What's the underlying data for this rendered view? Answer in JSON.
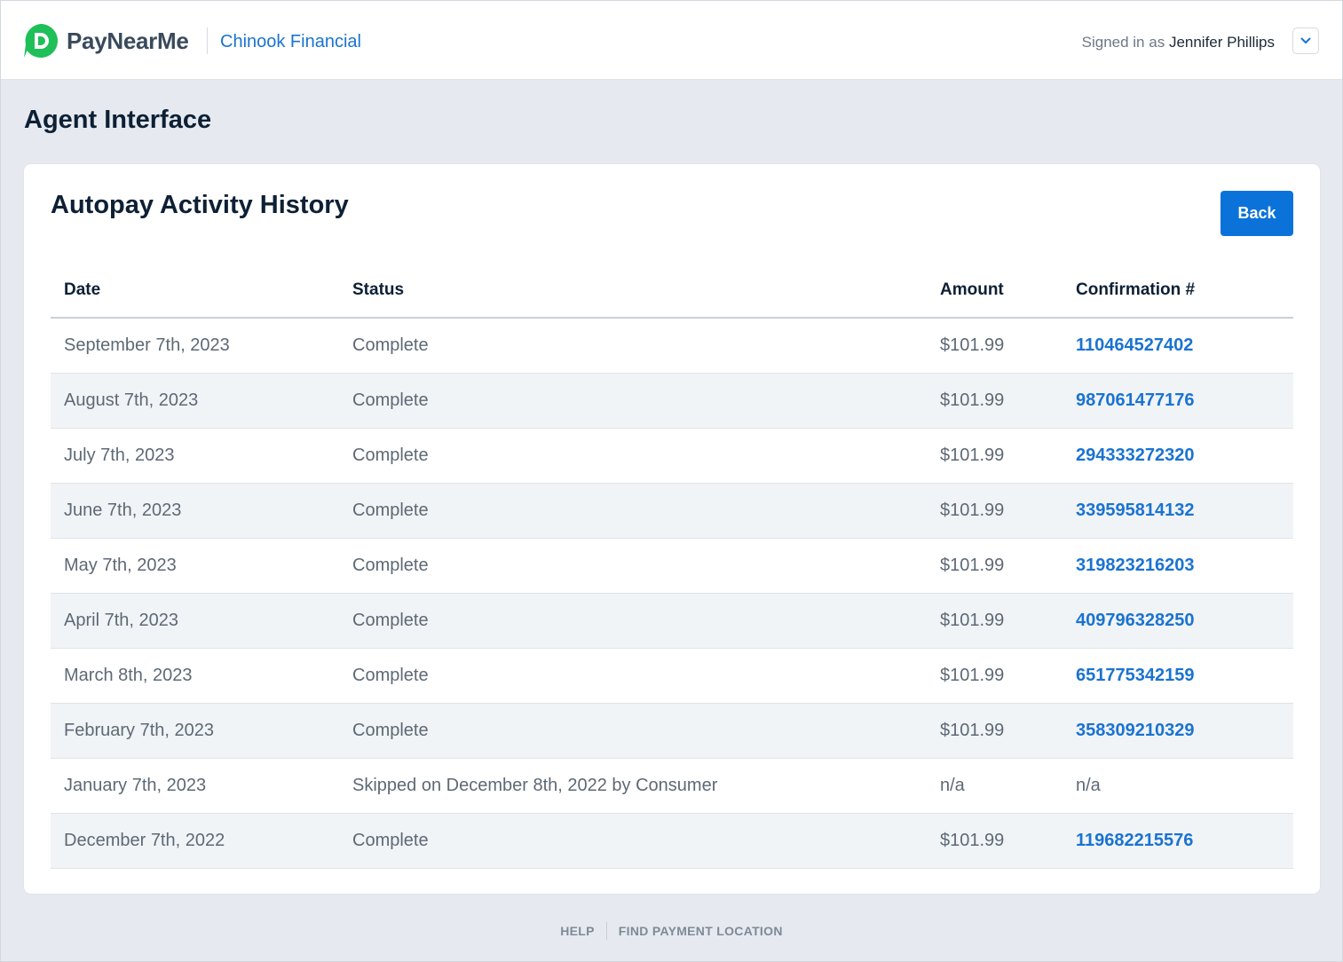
{
  "header": {
    "brand": "PayNearMe",
    "merchant": "Chinook Financial",
    "signed_in_prefix": "Signed in as",
    "user_name": "Jennifer Phillips"
  },
  "page": {
    "title": "Agent Interface"
  },
  "card": {
    "title": "Autopay Activity History",
    "back_label": "Back"
  },
  "table": {
    "columns": [
      "Date",
      "Status",
      "Amount",
      "Confirmation #"
    ],
    "rows": [
      {
        "date": "September 7th, 2023",
        "status": "Complete",
        "amount": "$101.99",
        "confirmation": "110464527402"
      },
      {
        "date": "August 7th, 2023",
        "status": "Complete",
        "amount": "$101.99",
        "confirmation": "987061477176"
      },
      {
        "date": "July 7th, 2023",
        "status": "Complete",
        "amount": "$101.99",
        "confirmation": "294333272320"
      },
      {
        "date": "June 7th, 2023",
        "status": "Complete",
        "amount": "$101.99",
        "confirmation": "339595814132"
      },
      {
        "date": "May 7th, 2023",
        "status": "Complete",
        "amount": "$101.99",
        "confirmation": "319823216203"
      },
      {
        "date": "April 7th, 2023",
        "status": "Complete",
        "amount": "$101.99",
        "confirmation": "409796328250"
      },
      {
        "date": "March 8th, 2023",
        "status": "Complete",
        "amount": "$101.99",
        "confirmation": "651775342159"
      },
      {
        "date": "February 7th, 2023",
        "status": "Complete",
        "amount": "$101.99",
        "confirmation": "358309210329"
      },
      {
        "date": "January 7th, 2023",
        "status": "Skipped on December 8th, 2022 by Consumer",
        "amount": "n/a",
        "confirmation": "n/a"
      },
      {
        "date": "December 7th, 2022",
        "status": "Complete",
        "amount": "$101.99",
        "confirmation": "119682215576"
      }
    ]
  },
  "footer": {
    "help": "HELP",
    "find_location": "FIND PAYMENT LOCATION"
  },
  "colors": {
    "brand_green": "#1fbf5a",
    "link_blue": "#1a73d1",
    "button_blue": "#0b72d9",
    "page_bg": "#e6eaf0"
  },
  "icons": {
    "logo": "paynearme-logo-icon",
    "menu": "chevron-down-icon"
  }
}
